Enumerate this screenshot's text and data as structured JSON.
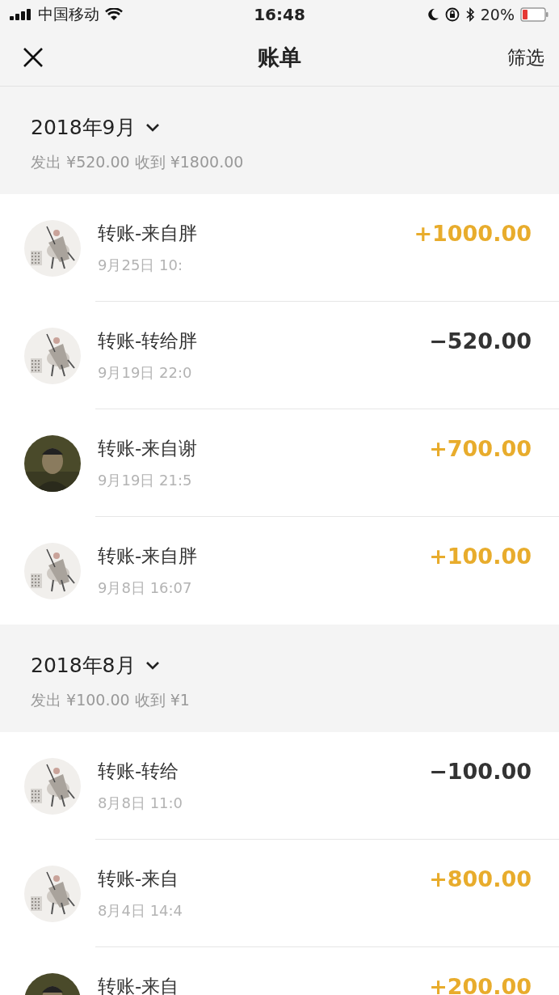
{
  "status_bar": {
    "carrier": "中国移动",
    "time": "16:48",
    "battery": "20%"
  },
  "nav": {
    "title": "账单",
    "action": "筛选"
  },
  "months": [
    {
      "title": "2018年9月",
      "summary": "发出 ¥520.00 收到 ¥1800.00",
      "entries": [
        {
          "avatar": {
            "kind": "painting"
          },
          "title": "转账-来自胖",
          "time": "9月25日 10:",
          "amount": "+1000.00",
          "kind": "income"
        },
        {
          "avatar": {
            "kind": "painting"
          },
          "title": "转账-转给胖",
          "time": "9月19日 22:0",
          "amount": "−520.00",
          "kind": "expense"
        },
        {
          "title": "转账-来自谢",
          "time": "9月19日 21:5",
          "amount": "+700.00",
          "kind": "income"
        },
        {
          "avatar": {
            "kind": "painting"
          },
          "title": "转账-来自胖",
          "time": "9月8日 16:07",
          "amount": "+100.00",
          "kind": "income"
        }
      ]
    },
    {
      "title": "2018年8月",
      "summary": "发出 ¥100.00 收到 ¥1",
      "entries": [
        {
          "avatar": {
            "kind": "painting"
          },
          "title": "转账-转给",
          "time": "8月8日 11:0",
          "amount": "−100.00",
          "kind": "expense"
        },
        {
          "avatar": {
            "kind": "painting"
          },
          "title": "转账-来自",
          "time": "8月4日 14:4",
          "amount": "+800.00",
          "kind": "income"
        },
        {
          "title": "转账-来自",
          "amount": "+200.00",
          "kind": "income"
        }
      ]
    }
  ]
}
